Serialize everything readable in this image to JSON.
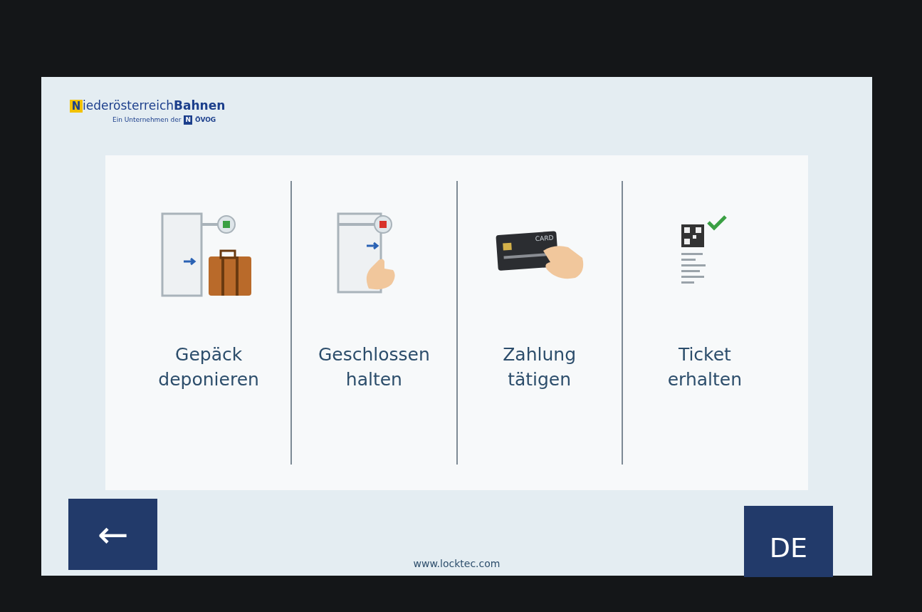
{
  "logo": {
    "badge": "N",
    "name": "iederösterreich",
    "name_bold": "Bahnen",
    "tagline": "Ein Unternehmen der",
    "tag_badge": "N",
    "tag_name": "ÖVOG"
  },
  "steps": [
    {
      "kind": "luggage",
      "lines": [
        "Gepäck",
        "deponieren"
      ]
    },
    {
      "kind": "door",
      "lines": [
        "Geschlossen",
        "halten"
      ]
    },
    {
      "kind": "card",
      "card_label": "CARD",
      "lines": [
        "Zahlung",
        "tätigen"
      ]
    },
    {
      "kind": "ticket",
      "lines": [
        "Ticket",
        "erhalten"
      ]
    }
  ],
  "back_button": "←",
  "language_button": "DE",
  "footer": "www.locktec.com"
}
